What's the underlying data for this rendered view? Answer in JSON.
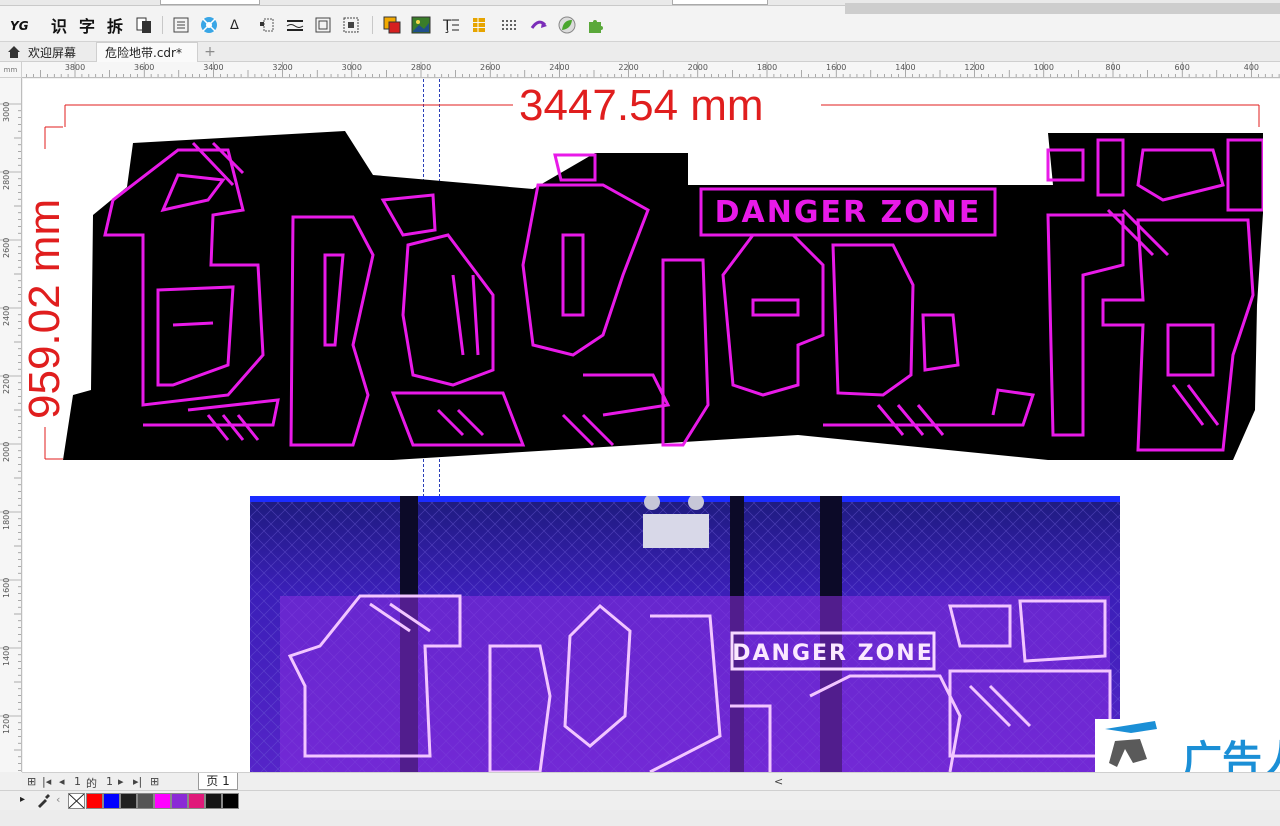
{
  "toolbar": {
    "text_tools": [
      "识",
      "字",
      "拆"
    ],
    "icons": [
      "yg-logo-icon",
      "recognize-text-icon",
      "character-icon",
      "split-icon",
      "page-copy-icon",
      "align-icon",
      "node-icon",
      "connector-icon",
      "distribute-icon",
      "line-icon",
      "frame-icon",
      "grid-icon",
      "color-fill-icon",
      "image-icon",
      "text-align-icon",
      "table-icon",
      "dots-icon",
      "arrow-icon",
      "leaf-icon",
      "plugin-icon"
    ]
  },
  "tabs": {
    "welcome": "欢迎屏幕",
    "document": "危险地带.cdr*",
    "add": "+"
  },
  "rulers": {
    "unit_corner": "mm",
    "horizontal_labels": [
      "3800",
      "3600",
      "3400",
      "3200",
      "3000",
      "2800",
      "2600",
      "2400",
      "2200",
      "2000",
      "1800",
      "1600",
      "1400",
      "1200",
      "1000",
      "800",
      "600",
      "400"
    ],
    "vertical_labels": [
      "3000",
      "2800",
      "2600",
      "2400",
      "2200",
      "2000",
      "1800",
      "1600",
      "1400",
      "1200"
    ]
  },
  "dimensions": {
    "width": "3447.54 mm",
    "height": "959.02 mm"
  },
  "artwork": {
    "title_chars": [
      "危",
      "险",
      "地",
      "带"
    ],
    "subtitle": "DANGER ZONE",
    "neon_color": "#e81ae8",
    "fill_color": "#000000"
  },
  "photo": {
    "subtitle": "DANGER ZONE",
    "background_color": "#2a1ea8",
    "glow_color": "#c060ff"
  },
  "pagenav": {
    "current": "1",
    "of": "的",
    "total": "1",
    "page_tab": "页 1"
  },
  "palette": {
    "colors": [
      "#ff0000",
      "#0000ff",
      "#202020",
      "#555555",
      "#ff00ff",
      "#8b2ad6",
      "#e0197a",
      "#161616",
      "#000000"
    ]
  },
  "watermark": {
    "text": "广告人"
  }
}
